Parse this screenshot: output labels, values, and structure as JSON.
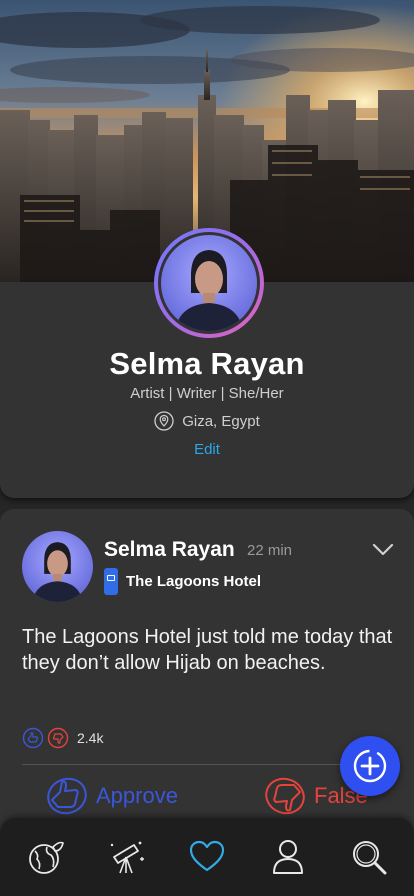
{
  "profile": {
    "name": "Selma Rayan",
    "bio": "Artist | Writer | She/Her",
    "location": "Giza, Egypt",
    "edit_label": "Edit"
  },
  "post": {
    "author": "Selma Rayan",
    "time": "22 min",
    "place": "The Lagoons Hotel",
    "text": "The Lagoons Hotel just told me today that they don’t allow Hijab on beaches.",
    "reaction_count": "2.4k",
    "approve_label": "Approve",
    "false_label": "False"
  },
  "colors": {
    "accent_blue": "#2aa8e8",
    "fab": "#2f4ff0",
    "approve": "#3b57d9",
    "false": "#e3443c",
    "nav_active": "#35a8e6"
  },
  "nav": {
    "items": [
      "globe-leaf-icon",
      "telescope-icon",
      "heart-icon",
      "user-icon",
      "search-icon"
    ],
    "active": "heart-icon"
  }
}
